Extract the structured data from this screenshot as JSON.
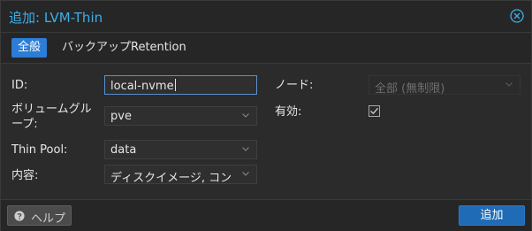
{
  "window": {
    "title": "追加: LVM-Thin"
  },
  "tabs": [
    {
      "label": "全般",
      "active": true
    },
    {
      "label": "バックアップRetention",
      "active": false
    }
  ],
  "form": {
    "id": {
      "label": "ID:",
      "value": "local-nvme"
    },
    "vg": {
      "label_line1": "ボリュームグル",
      "label_line2": "ープ:",
      "value": "pve"
    },
    "thinpool": {
      "label": "Thin Pool:",
      "value": "data"
    },
    "content": {
      "label": "内容:",
      "value": "ディスクイメージ, コン"
    },
    "node": {
      "label": "ノード:",
      "value": "全部 (無制限)"
    },
    "enabled": {
      "label": "有効:",
      "checked": true
    }
  },
  "footer": {
    "help_label": "ヘルプ",
    "add_label": "追加"
  },
  "colors": {
    "accent": "#3daee9",
    "primary_button": "#1f6bb6",
    "background": "#2b2b2b"
  }
}
